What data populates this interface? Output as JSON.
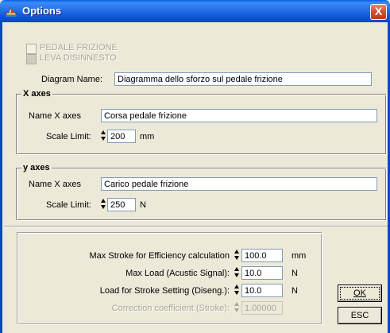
{
  "window": {
    "title": "Options",
    "close_glyph": "X",
    "app_icon": "ship-icon"
  },
  "checkboxes": [
    {
      "label": "PEDALE FRIZIONE",
      "checked": false
    },
    {
      "label": "LEVA DISINNESTO",
      "checked": false
    }
  ],
  "diagram": {
    "name_label": "Diagram Name:",
    "name_value": "Diagramma dello sforzo sul pedale frizione"
  },
  "x_axes": {
    "legend": "X axes",
    "name_label": "Name X axes",
    "name_value": "Corsa pedale frizione",
    "scale_label": "Scale Limit:",
    "scale_value": "200",
    "unit": "mm"
  },
  "y_axes": {
    "legend": "y axes",
    "name_label": "Name X axes",
    "name_value": "Carico pedale frizione",
    "scale_label": "Scale Limit:",
    "scale_value": "250",
    "unit": "N"
  },
  "params": [
    {
      "label": "Max Stroke for Efficiency calculation",
      "value": "100.0",
      "unit": "mm",
      "enabled": true
    },
    {
      "label": "Max Load (Acustic Signal):",
      "value": "10.0",
      "unit": "N",
      "enabled": true
    },
    {
      "label": "Load for Stroke Setting (Diseng.):",
      "value": "10.0",
      "unit": "N",
      "enabled": true
    },
    {
      "label": "Correction coefficient (Stroke):",
      "value": "1.00000",
      "unit": "",
      "enabled": false
    }
  ],
  "buttons": {
    "ok": "OK",
    "esc": "ESC"
  }
}
